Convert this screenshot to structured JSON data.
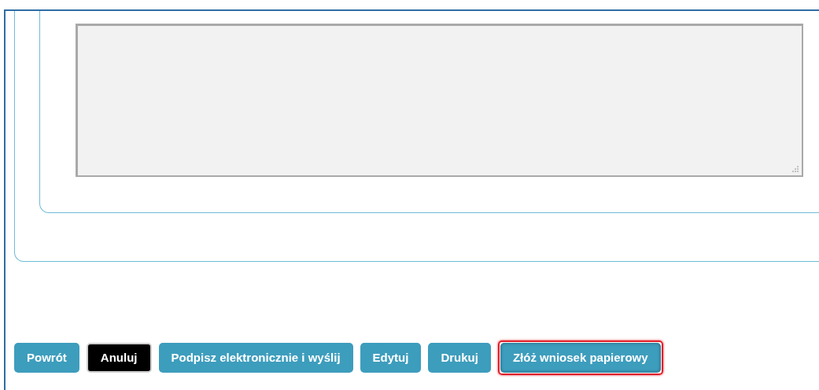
{
  "textarea": {
    "disabled": true
  },
  "buttons": [
    {
      "label": "Powrót",
      "kind": "primary",
      "highlighted": false
    },
    {
      "label": "Anuluj",
      "kind": "dark",
      "highlighted": false
    },
    {
      "label": "Podpisz elektronicznie i wyślij",
      "kind": "primary",
      "highlighted": false
    },
    {
      "label": "Edytuj",
      "kind": "primary",
      "highlighted": false
    },
    {
      "label": "Drukuj",
      "kind": "primary",
      "highlighted": false
    },
    {
      "label": "Złóż wniosek papierowy",
      "kind": "primary",
      "highlighted": true
    }
  ]
}
